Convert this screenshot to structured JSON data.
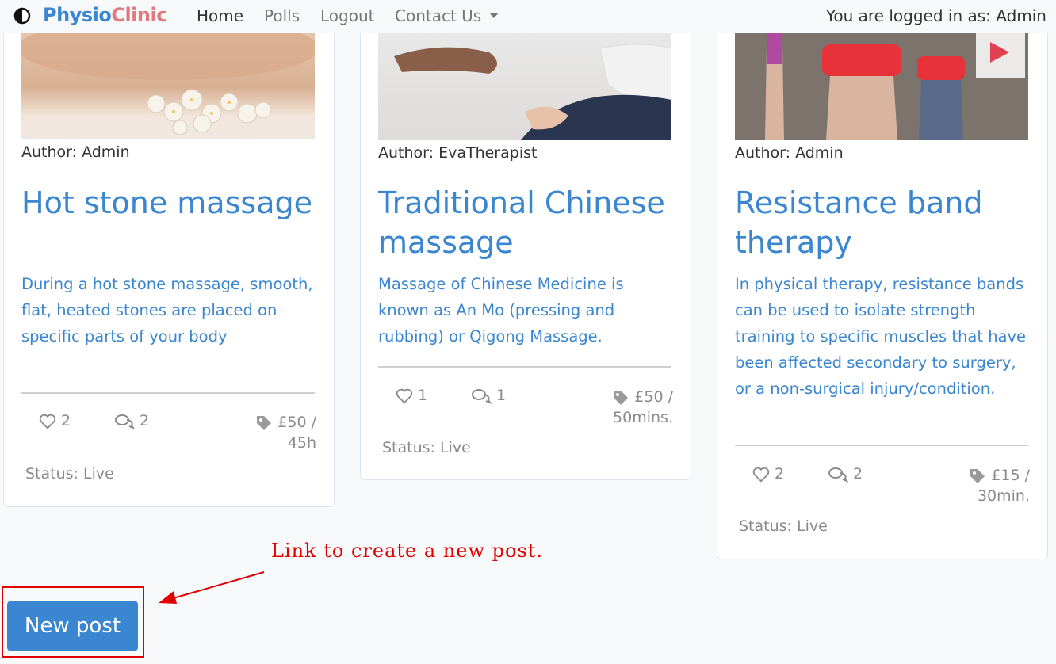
{
  "navbar": {
    "brand_part1": "Physio",
    "brand_part2": "Clinic",
    "items": [
      {
        "label": "Home"
      },
      {
        "label": "Polls"
      },
      {
        "label": "Logout"
      },
      {
        "label": "Contact Us"
      }
    ],
    "logged_in_text": "You are logged in as: Admin"
  },
  "posts": [
    {
      "author": "Author: Admin",
      "title": "Hot stone massage",
      "description": "During a hot stone massage, smooth, flat, heated stones are placed on specific parts of your body",
      "likes": "2",
      "comments": "2",
      "price_line1": "£50 /",
      "price_line2": "45h",
      "status": "Status: Live"
    },
    {
      "author": "Author: EvaTherapist",
      "title": "Traditional Chinese massage",
      "description": "Massage of Chinese Medicine is known as An Mo (pressing and rubbing) or Qigong Massage.",
      "likes": "1",
      "comments": "1",
      "price_line1": "£50 /",
      "price_line2": "50mins.",
      "status": "Status: Live"
    },
    {
      "author": "Author: Admin",
      "title": "Resistance band therapy",
      "description": "In physical therapy, resistance bands can be used to isolate strength training to specific muscles that have been affected secondary to surgery, or a non-surgical injury/condition.",
      "likes": "2",
      "comments": "2",
      "price_line1": "£15 /",
      "price_line2": "30min.",
      "status": "Status: Live"
    }
  ],
  "annotation": "Link to create a new post.",
  "new_post_label": "New post",
  "colors": {
    "primary": "#3a86d0",
    "brand_accent": "#e07a7c",
    "annotation": "#e00000",
    "muted": "#8a8a8a"
  }
}
